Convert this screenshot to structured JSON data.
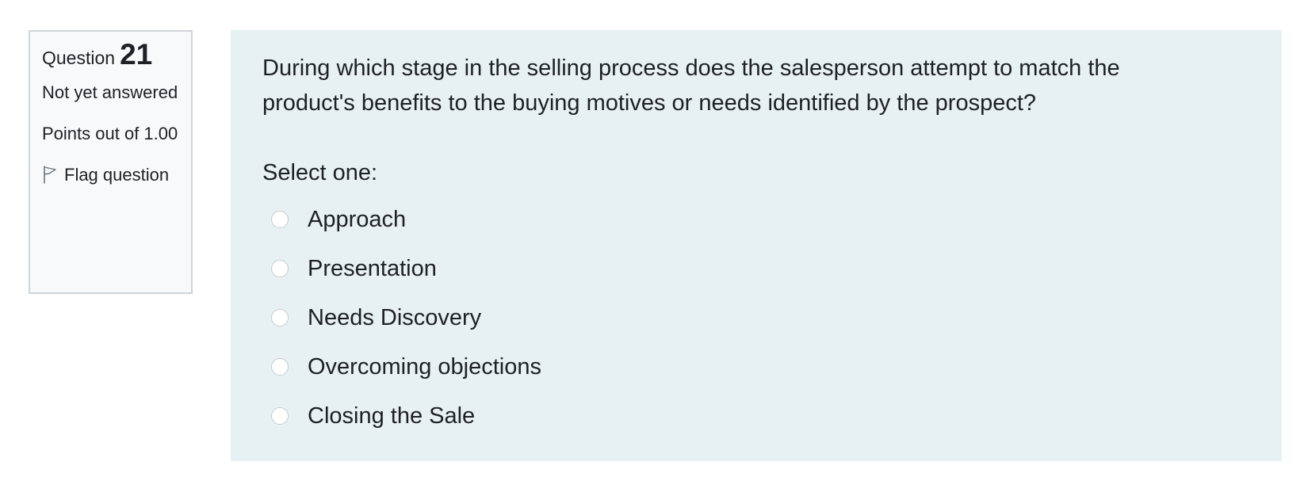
{
  "question_info": {
    "label": "Question",
    "number": "21",
    "state": "Not yet answered",
    "grade": "Points out of 1.00",
    "flag_label": "Flag question"
  },
  "question": {
    "text": "During which stage in the selling process does the salesperson attempt to match the product's benefits to the buying motives or needs identified by the prospect?",
    "prompt": "Select one:",
    "answers": [
      {
        "label": "Approach",
        "selected": false
      },
      {
        "label": "Presentation",
        "selected": false
      },
      {
        "label": "Needs Discovery",
        "selected": false
      },
      {
        "label": "Overcoming objections",
        "selected": false
      },
      {
        "label": "Closing the Sale",
        "selected": false
      }
    ]
  },
  "icons": {
    "flag": "flag-icon"
  },
  "colors": {
    "content_background": "#e7f1f4",
    "info_background": "#f8f9fa",
    "info_border": "#cfd4da",
    "text": "#1d2125"
  }
}
